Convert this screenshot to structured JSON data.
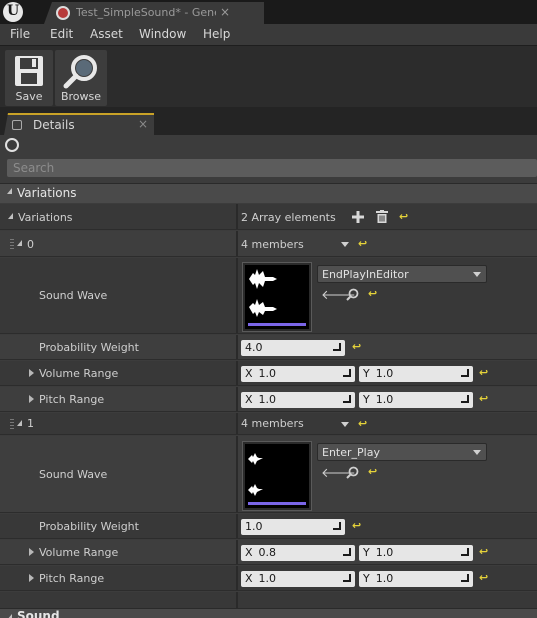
{
  "window": {
    "tab_title": "Test_SimpleSound* - Gene",
    "close": "×"
  },
  "menu": [
    "File",
    "Edit",
    "Asset",
    "Window",
    "Help"
  ],
  "toolbar": {
    "save_label": "Save",
    "browse_label": "Browse"
  },
  "details_tab": {
    "label": "Details",
    "close": "×"
  },
  "search": {
    "placeholder": "Search"
  },
  "variations_category": "Variations",
  "variations_row": {
    "label": "Variations",
    "summary": "2 Array elements"
  },
  "elements": [
    {
      "index": "0",
      "members": "4 members",
      "sound_wave_label": "Sound Wave",
      "sound_wave_asset": "EndPlayInEditor",
      "probability_label": "Probability Weight",
      "probability_value": "4.0",
      "volume_label": "Volume Range",
      "volume_x": "1.0",
      "volume_y": "1.0",
      "pitch_label": "Pitch Range",
      "pitch_x": "1.0",
      "pitch_y": "1.0"
    },
    {
      "index": "1",
      "members": "4 members",
      "sound_wave_label": "Sound Wave",
      "sound_wave_asset": "Enter_Play",
      "probability_label": "Probability Weight",
      "probability_value": "1.0",
      "volume_label": "Volume Range",
      "volume_x": "0.8",
      "volume_y": "1.0",
      "pitch_label": "Pitch Range",
      "pitch_x": "1.0",
      "pitch_y": "1.0"
    }
  ],
  "axis": {
    "x": "X",
    "y": "Y"
  },
  "reset_glyph": "↩",
  "next_category": "Sound",
  "colors": {
    "accent_tab": "#c9a227",
    "reset_arrow": "#e5d23a",
    "thumbnail_bar": "#7b66e8",
    "asset_tab_icon": "#b73a3a"
  }
}
